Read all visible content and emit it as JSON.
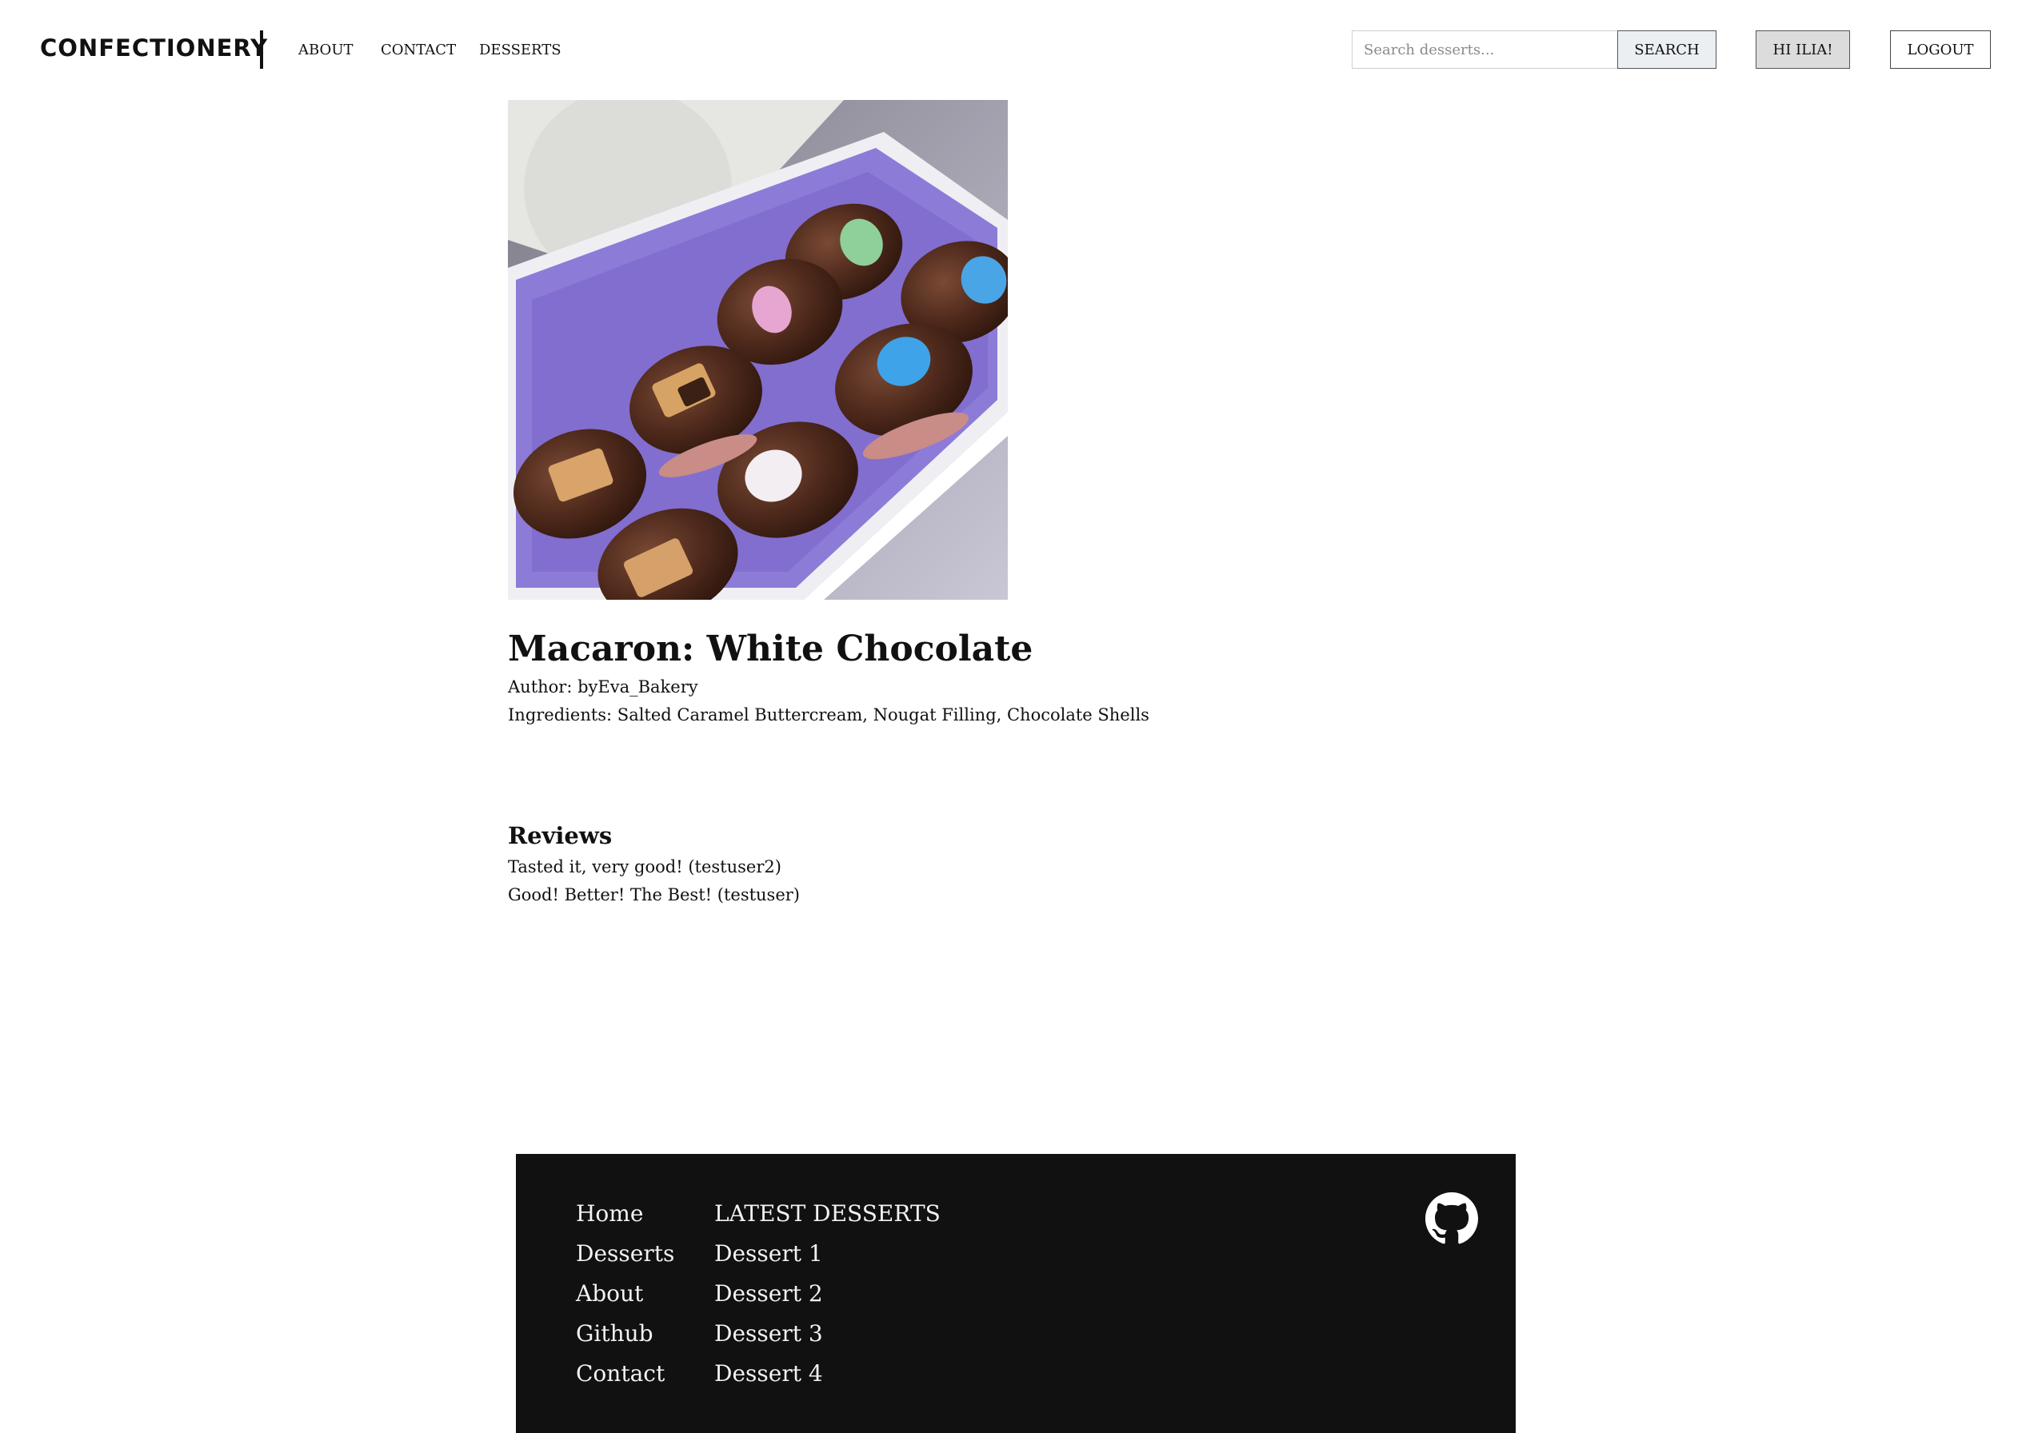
{
  "header": {
    "logo": "CONFECTIONERY",
    "nav": [
      "ABOUT",
      "CONTACT",
      "DESSERTS"
    ],
    "search": {
      "placeholder": "Search desserts...",
      "value": ""
    },
    "search_button": "SEARCH",
    "user_button": "HI ILIA!",
    "logout_button": "LOGOUT"
  },
  "product": {
    "image_subject": "chocolate-covered macarons with candy eggs in a box with purple tissue paper",
    "title": "Macaron: White Chocolate",
    "author": "Author: byEva_Bakery",
    "ingredients": "Ingredients: Salted Caramel Buttercream, Nougat Filling, Chocolate Shells"
  },
  "reviews": {
    "heading": "Reviews",
    "items": [
      "Tasted it, very good! (testuser2)",
      "Good! Better! The Best! (testuser)"
    ]
  },
  "footer": {
    "links": [
      "Home",
      "Desserts",
      "About",
      "Github",
      "Contact"
    ],
    "latest_heading": "LATEST DESSERTS",
    "latest": [
      "Dessert 1",
      "Dessert 2",
      "Dessert 3",
      "Dessert 4"
    ],
    "icon": "github-icon"
  },
  "colors": {
    "footer_bg": "#111111",
    "search_button_bg": "#eceff2",
    "user_button_bg": "#dcdcdc"
  }
}
